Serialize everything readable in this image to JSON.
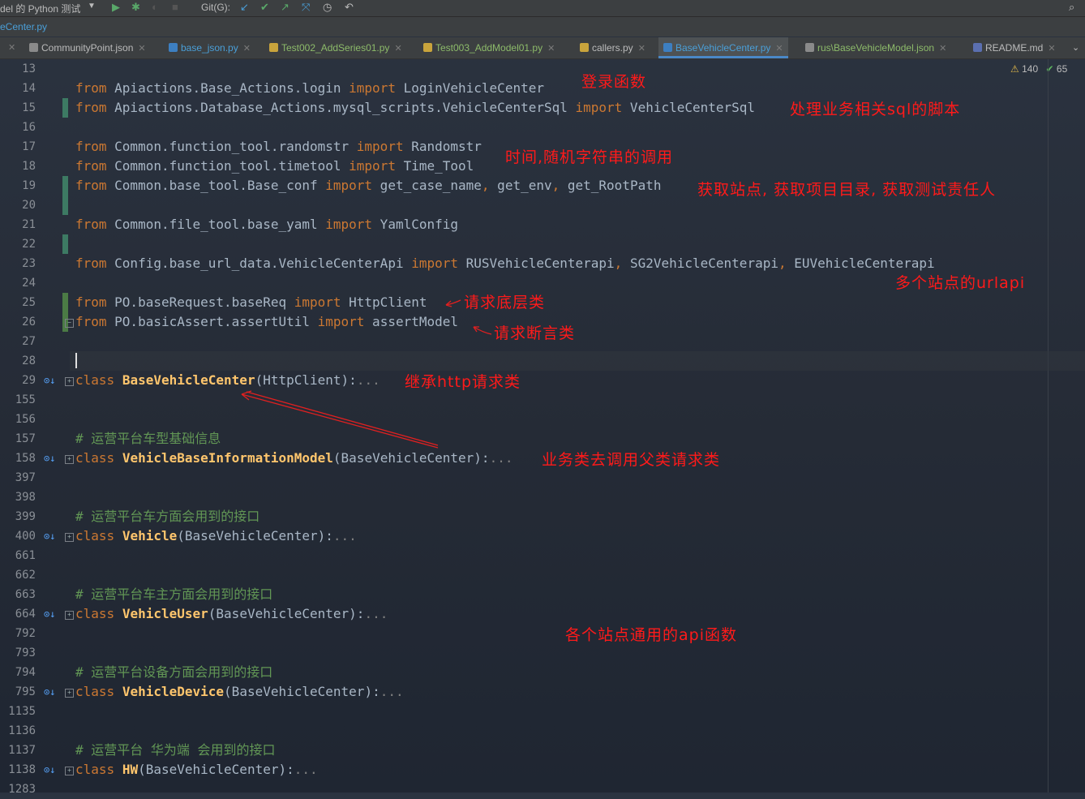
{
  "toolbar": {
    "run_config": "del 的 Python 测试",
    "git_label": "Git(G):"
  },
  "breadcrumb": "eCenter.py",
  "tabs": [
    {
      "label": "CommunityPoint.json"
    },
    {
      "label": "base_json.py"
    },
    {
      "label": "Test002_AddSeries01.py"
    },
    {
      "label": "Test003_AddModel01.py"
    },
    {
      "label": "callers.py"
    },
    {
      "label": "BaseVehicleCenter.py"
    },
    {
      "label": "rus\\BaseVehicleModel.json"
    },
    {
      "label": "README.md"
    }
  ],
  "inspections": {
    "warnings": "140",
    "weak_warnings": "65"
  },
  "lines": [
    {
      "num": "13"
    },
    {
      "num": "14",
      "t": [
        [
          "kw",
          "from"
        ],
        [
          "p",
          " Apiactions.Base_Actions.login "
        ],
        [
          "kw",
          "import"
        ],
        [
          "p",
          " LoginVehicleCenter"
        ]
      ]
    },
    {
      "num": "15",
      "t": [
        [
          "kw",
          "from"
        ],
        [
          "p",
          " Apiactions.Database_Actions.mysql_scripts.VehicleCenterSql "
        ],
        [
          "kw",
          "import"
        ],
        [
          "p",
          " VehicleCenterSql"
        ]
      ]
    },
    {
      "num": "16"
    },
    {
      "num": "17",
      "t": [
        [
          "kw",
          "from"
        ],
        [
          "p",
          " Common.function_tool.randomstr "
        ],
        [
          "kw",
          "import"
        ],
        [
          "p",
          " Randomstr"
        ]
      ]
    },
    {
      "num": "18",
      "t": [
        [
          "kw",
          "from"
        ],
        [
          "p",
          " Common.function_tool.timetool "
        ],
        [
          "kw",
          "import"
        ],
        [
          "p",
          " Time_Tool"
        ]
      ]
    },
    {
      "num": "19",
      "t": [
        [
          "kw",
          "from"
        ],
        [
          "p",
          " Common.base_tool.Base_conf "
        ],
        [
          "kw",
          "import"
        ],
        [
          "p",
          " get_case_name"
        ],
        [
          "kw",
          ","
        ],
        [
          "p",
          " get_env"
        ],
        [
          "kw",
          ","
        ],
        [
          "p",
          " get_RootPath"
        ]
      ]
    },
    {
      "num": "20"
    },
    {
      "num": "21",
      "t": [
        [
          "kw",
          "from"
        ],
        [
          "p",
          " Common.file_tool.base_yaml "
        ],
        [
          "kw",
          "import"
        ],
        [
          "p",
          " YamlConfig"
        ]
      ]
    },
    {
      "num": "22"
    },
    {
      "num": "23",
      "t": [
        [
          "kw",
          "from"
        ],
        [
          "p",
          " Config.base_url_data.VehicleCenterApi "
        ],
        [
          "kw",
          "import"
        ],
        [
          "p",
          " RUSVehicleCenterapi"
        ],
        [
          "kw",
          ","
        ],
        [
          "p",
          " SG2VehicleCenterapi"
        ],
        [
          "kw",
          ","
        ],
        [
          "p",
          " EUVehicleCenterapi"
        ]
      ]
    },
    {
      "num": "24"
    },
    {
      "num": "25",
      "t": [
        [
          "kw",
          "from"
        ],
        [
          "p",
          " PO.baseRequest.baseReq "
        ],
        [
          "kw",
          "import"
        ],
        [
          "p",
          " HttpClient"
        ]
      ]
    },
    {
      "num": "26",
      "t": [
        [
          "kw",
          "from"
        ],
        [
          "p",
          " PO.basicAssert.assertUtil "
        ],
        [
          "kw",
          "import"
        ],
        [
          "p",
          " assertModel"
        ]
      ]
    },
    {
      "num": "27"
    },
    {
      "num": "28"
    },
    {
      "num": "29",
      "t": [
        [
          "kw",
          "class"
        ],
        [
          "p",
          " "
        ],
        [
          "cls",
          "BaseVehicleCenter"
        ],
        [
          "p",
          "(HttpClient):"
        ],
        [
          "dim",
          "..."
        ]
      ]
    },
    {
      "num": "155"
    },
    {
      "num": "156"
    },
    {
      "num": "157",
      "t": [
        [
          "cmt",
          "# 运营平台车型基础信息"
        ]
      ]
    },
    {
      "num": "158",
      "t": [
        [
          "kw",
          "class"
        ],
        [
          "p",
          " "
        ],
        [
          "cls",
          "VehicleBaseInformationModel"
        ],
        [
          "p",
          "(BaseVehicleCenter):"
        ],
        [
          "dim",
          "..."
        ]
      ]
    },
    {
      "num": "397"
    },
    {
      "num": "398"
    },
    {
      "num": "399",
      "t": [
        [
          "cmt",
          "# 运营平台车方面会用到的接口"
        ]
      ]
    },
    {
      "num": "400",
      "t": [
        [
          "kw",
          "class"
        ],
        [
          "p",
          " "
        ],
        [
          "cls",
          "Vehicle"
        ],
        [
          "p",
          "(BaseVehicleCenter):"
        ],
        [
          "dim",
          "..."
        ]
      ]
    },
    {
      "num": "661"
    },
    {
      "num": "662"
    },
    {
      "num": "663",
      "t": [
        [
          "cmt",
          "# 运营平台车主方面会用到的接口"
        ]
      ]
    },
    {
      "num": "664",
      "t": [
        [
          "kw",
          "class"
        ],
        [
          "p",
          " "
        ],
        [
          "cls",
          "VehicleUser"
        ],
        [
          "p",
          "(BaseVehicleCenter):"
        ],
        [
          "dim",
          "..."
        ]
      ]
    },
    {
      "num": "792"
    },
    {
      "num": "793"
    },
    {
      "num": "794",
      "t": [
        [
          "cmt",
          "# 运营平台设备方面会用到的接口"
        ]
      ]
    },
    {
      "num": "795",
      "t": [
        [
          "kw",
          "class"
        ],
        [
          "p",
          " "
        ],
        [
          "cls",
          "VehicleDevice"
        ],
        [
          "p",
          "(BaseVehicleCenter):"
        ],
        [
          "dim",
          "..."
        ]
      ]
    },
    {
      "num": "1135"
    },
    {
      "num": "1136"
    },
    {
      "num": "1137",
      "t": [
        [
          "cmt",
          "# 运营平台 华为端 会用到的接口"
        ]
      ]
    },
    {
      "num": "1138",
      "t": [
        [
          "kw",
          "class"
        ],
        [
          "p",
          " "
        ],
        [
          "cls",
          "HW"
        ],
        [
          "p",
          "(BaseVehicleCenter):"
        ],
        [
          "dim",
          "..."
        ]
      ]
    },
    {
      "num": "1283"
    }
  ],
  "annotations": {
    "login": "登录函数",
    "sql": "处理业务相关sql的脚本",
    "time_random": "时间,随机字符串的调用",
    "env": "获取站点, 获取项目目录, 获取测试责任人",
    "urlapi": "多个站点的urlapi",
    "http_base": "请求底层类",
    "assert": "请求断言类",
    "inherit": "继承http请求类",
    "business": "业务类去调用父类请求类",
    "common_api": "各个站点通用的api函数"
  }
}
